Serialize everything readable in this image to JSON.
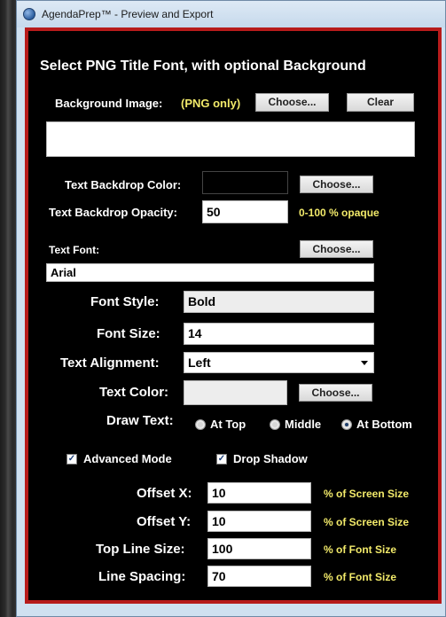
{
  "window": {
    "title": "AgendaPrep™ - Preview and Export"
  },
  "panel": {
    "heading": "Select PNG Title Font, with optional Background",
    "bg_label": "Background Image:",
    "bg_hint": "(PNG only)",
    "bg_choose": "Choose...",
    "bg_clear": "Clear",
    "bg_path": "",
    "backdrop_color_label": "Text Backdrop Color:",
    "backdrop_color_value": "#000000",
    "backdrop_choose": "Choose...",
    "opacity_label": "Text Backdrop Opacity:",
    "opacity_value": "50",
    "opacity_hint": "0-100 % opaque",
    "font_label": "Text Font:",
    "font_choose": "Choose...",
    "font_value": "Arial",
    "style_label": "Font Style:",
    "style_value": "Bold",
    "size_label": "Font Size:",
    "size_value": "14",
    "align_label": "Text Alignment:",
    "align_value": "Left",
    "color_label": "Text Color:",
    "color_choose": "Choose...",
    "draw_label": "Draw Text:",
    "draw_top": "At Top",
    "draw_middle": "Middle",
    "draw_bottom": "At Bottom",
    "draw_selected": "At Bottom",
    "advanced_label": "Advanced Mode",
    "advanced_checked": true,
    "shadow_label": "Drop Shadow",
    "shadow_checked": true,
    "offset_x_label": "Offset X:",
    "offset_x_value": "10",
    "offset_x_unit": "% of Screen Size",
    "offset_y_label": "Offset Y:",
    "offset_y_value": "10",
    "offset_y_unit": "% of Screen Size",
    "top_line_label": "Top Line Size:",
    "top_line_value": "100",
    "top_line_unit": "% of Font Size",
    "spacing_label": "Line Spacing:",
    "spacing_value": "70",
    "spacing_unit": "% of Font Size"
  },
  "colors": {
    "frame": "#b71b1b",
    "accent_text": "#f2ea6a"
  }
}
